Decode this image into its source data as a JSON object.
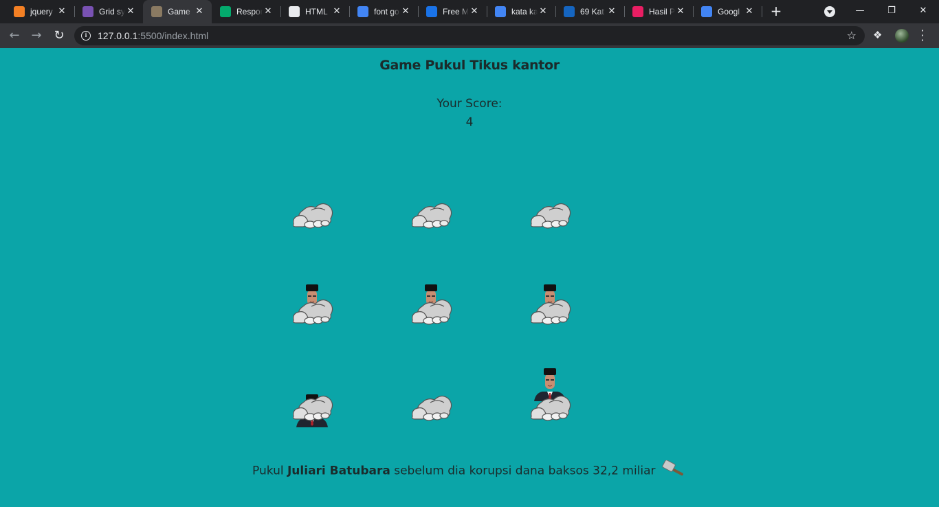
{
  "browser": {
    "tabs": [
      {
        "title": "jquery",
        "favicon": "stackoverflow-icon",
        "color": "#f48024"
      },
      {
        "title": "Grid sy",
        "favicon": "bootstrap-icon",
        "color": "#7952b3"
      },
      {
        "title": "Game",
        "favicon": "game-icon",
        "color": "#8a7a62",
        "active": true
      },
      {
        "title": "Respon",
        "favicon": "w3schools-icon",
        "color": "#04aa6d"
      },
      {
        "title": "HTML",
        "favicon": "globe-icon",
        "color": "#e8eaed"
      },
      {
        "title": "font go",
        "favicon": "google-icon",
        "color": "#4285f4"
      },
      {
        "title": "Free M",
        "favicon": "link-icon",
        "color": "#1a73e8"
      },
      {
        "title": "kata ka",
        "favicon": "google-icon",
        "color": "#4285f4"
      },
      {
        "title": "69 Kat",
        "favicon": "j-icon",
        "color": "#1565c0"
      },
      {
        "title": "Hasil P",
        "favicon": "pinwheel-icon",
        "color": "#e91e63"
      },
      {
        "title": "Googl",
        "favicon": "translate-icon",
        "color": "#4285f4"
      }
    ],
    "url_host": "127.0.0.1",
    "url_rest": ":5500/index.html"
  },
  "game": {
    "title": "Game Pukul Tikus kantor",
    "score_label": "Your Score:",
    "score": "4",
    "footer_prefix": "Pukul ",
    "footer_name": "Juliari Batubara",
    "footer_suffix": " sebelum dia korupsi dana baksos 32,2 miliar",
    "holes": [
      {
        "mole": "hidden"
      },
      {
        "mole": "hidden"
      },
      {
        "mole": "hidden"
      },
      {
        "mole": "up"
      },
      {
        "mole": "up"
      },
      {
        "mole": "up"
      },
      {
        "mole": "peek"
      },
      {
        "mole": "hidden"
      },
      {
        "mole": "full"
      }
    ]
  },
  "colors": {
    "page_bg": "#0ba5a8",
    "text": "#1b2b2b"
  }
}
